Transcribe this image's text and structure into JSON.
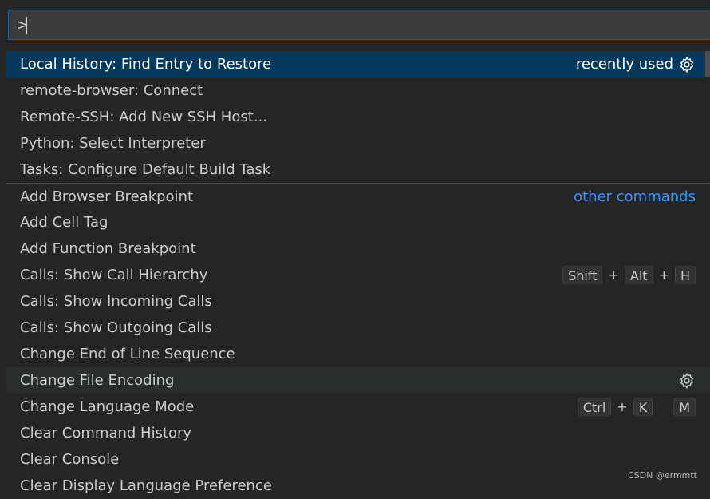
{
  "input": {
    "value": ">"
  },
  "items": [
    {
      "label": "Local History: Find Entry to Restore",
      "desc": "recently used",
      "gear": true
    },
    {
      "label": "remote-browser: Connect"
    },
    {
      "label": "Remote-SSH: Add New SSH Host..."
    },
    {
      "label": "Python: Select Interpreter"
    },
    {
      "label": "Tasks: Configure Default Build Task"
    },
    {
      "label": "Add Browser Breakpoint",
      "desc": "other commands"
    },
    {
      "label": "Add Cell Tag"
    },
    {
      "label": "Add Function Breakpoint"
    },
    {
      "label": "Calls: Show Call Hierarchy",
      "keys": [
        "Shift",
        "Alt",
        "H"
      ]
    },
    {
      "label": "Calls: Show Incoming Calls"
    },
    {
      "label": "Calls: Show Outgoing Calls"
    },
    {
      "label": "Change End of Line Sequence"
    },
    {
      "label": "Change File Encoding",
      "gear": true
    },
    {
      "label": "Change Language Mode",
      "keys": [
        "Ctrl",
        "K",
        "M"
      ]
    },
    {
      "label": "Clear Command History"
    },
    {
      "label": "Clear Console"
    },
    {
      "label": "Clear Display Language Preference"
    }
  ],
  "key_plus": "+",
  "watermark": "CSDN @ermmtt",
  "colors": {
    "selected": "#04395e",
    "link": "#3794ff",
    "border": "#0e639c"
  }
}
